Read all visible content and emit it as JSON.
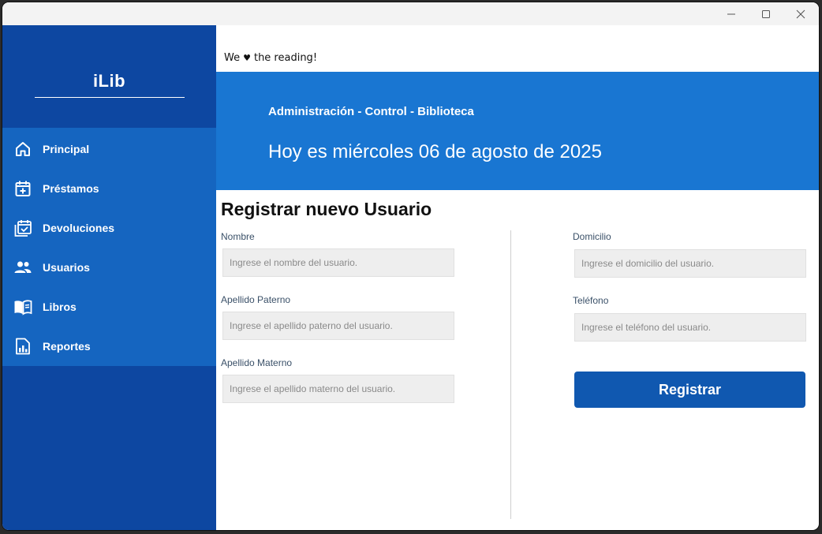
{
  "colors": {
    "sidebar_dark": "#0d47a1",
    "sidebar_nav": "#1565c0",
    "banner": "#1976d2",
    "button": "#1058b0",
    "input_bg": "#eeeeee"
  },
  "brand": {
    "name": "iLib"
  },
  "sidebar": {
    "items": [
      {
        "label": "Principal",
        "icon": "home-icon"
      },
      {
        "label": "Préstamos",
        "icon": "calendar-plus-icon"
      },
      {
        "label": "Devoluciones",
        "icon": "calendar-check-icon"
      },
      {
        "label": "Usuarios",
        "icon": "users-icon"
      },
      {
        "label": "Libros",
        "icon": "book-icon"
      },
      {
        "label": "Reportes",
        "icon": "report-icon"
      }
    ]
  },
  "tagline": {
    "before": "We",
    "heart": "♥",
    "after": "the reading!"
  },
  "banner": {
    "subtitle": "Administración - Control - Biblioteca",
    "date": "Hoy es miércoles 06 de agosto de 2025"
  },
  "form": {
    "title": "Registrar nuevo Usuario",
    "fields": {
      "nombre": {
        "label": "Nombre",
        "placeholder": "Ingrese el nombre del usuario.",
        "value": ""
      },
      "apellido_paterno": {
        "label": "Apellido Paterno",
        "placeholder": "Ingrese el apellido paterno del usuario.",
        "value": ""
      },
      "apellido_materno": {
        "label": "Apellido Materno",
        "placeholder": "Ingrese el apellido materno del usuario.",
        "value": ""
      },
      "domicilio": {
        "label": "Domicilio",
        "placeholder": "Ingrese el domicilio del usuario.",
        "value": ""
      },
      "telefono": {
        "label": "Teléfono",
        "placeholder": "Ingrese el teléfono del usuario.",
        "value": ""
      }
    },
    "submit_label": "Registrar"
  }
}
